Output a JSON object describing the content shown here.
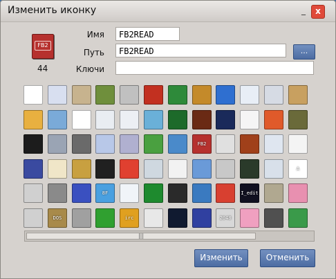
{
  "window": {
    "title": "Изменить иконку"
  },
  "titlebar": {
    "minimize_glyph": "_",
    "close_glyph": "x"
  },
  "icon_preview": {
    "label": "FB2",
    "index": "44"
  },
  "form": {
    "name_label": "Имя",
    "name_value": "FB2READ",
    "path_label": "Путь",
    "path_value": "FB2READ",
    "browse_label": "...",
    "keys_label": "Ключи",
    "keys_value": ""
  },
  "icon_grid": {
    "rows": [
      [
        {
          "name": "blank-window",
          "color": "#ffffff",
          "tag": ""
        },
        {
          "name": "checklist",
          "color": "#d8dff0",
          "tag": ""
        },
        {
          "name": "ubuntu-cd",
          "color": "#c7b38e",
          "tag": ""
        },
        {
          "name": "color-blocks",
          "color": "#6f8f3c",
          "tag": ""
        },
        {
          "name": "tic-tac-toe",
          "color": "#c0c0c0",
          "tag": ""
        },
        {
          "name": "mushroom",
          "color": "#c23020",
          "tag": ""
        },
        {
          "name": "chip-board",
          "color": "#2e8a3a",
          "tag": ""
        },
        {
          "name": "book-old",
          "color": "#c48a2a",
          "tag": ""
        },
        {
          "name": "xfce",
          "color": "#2f6fd0",
          "tag": ""
        },
        {
          "name": "mouse",
          "color": "#e8eef6",
          "tag": ""
        },
        {
          "name": "windows-stack",
          "color": "#d6dbe4",
          "tag": ""
        },
        {
          "name": "ship",
          "color": "#c8a060",
          "tag": ""
        }
      ],
      [
        {
          "name": "folder",
          "color": "#e8b040",
          "tag": ""
        },
        {
          "name": "monitor",
          "color": "#7aaad8",
          "tag": ""
        },
        {
          "name": "dots-molecule",
          "color": "#ffffff",
          "tag": ""
        },
        {
          "name": "text-window",
          "color": "#e9edf2",
          "tag": ""
        },
        {
          "name": "sudoku",
          "color": "#eceff4",
          "tag": ""
        },
        {
          "name": "map-window",
          "color": "#6ab0d8",
          "tag": ""
        },
        {
          "name": "cpu-chip",
          "color": "#1d6a2a",
          "tag": ""
        },
        {
          "name": "doom",
          "color": "#6a2a14",
          "tag": ""
        },
        {
          "name": "star-burst",
          "color": "#1a2a5a",
          "tag": ""
        },
        {
          "name": "document",
          "color": "#f5f5f5",
          "tag": ""
        },
        {
          "name": "window-colored",
          "color": "#e05a2a",
          "tag": ""
        },
        {
          "name": "tank",
          "color": "#6a6a3a",
          "tag": ""
        }
      ],
      [
        {
          "name": "terminal",
          "color": "#1c1c1c",
          "tag": ""
        },
        {
          "name": "cabinet",
          "color": "#9aa4b4",
          "tag": ""
        },
        {
          "name": "spike-ball",
          "color": "#6a6a6a",
          "tag": ""
        },
        {
          "name": "coins",
          "color": "#b8c8e8",
          "tag": ""
        },
        {
          "name": "p-tile",
          "color": "#b0b0d0",
          "tag": ""
        },
        {
          "name": "snake",
          "color": "#4aa040",
          "tag": ""
        },
        {
          "name": "circuit-board",
          "color": "#4a8aca",
          "tag": ""
        },
        {
          "name": "fb2-book",
          "color": "#b6312e",
          "tag": "FB2"
        },
        {
          "name": "disk-stack",
          "color": "#e0e0e0",
          "tag": ""
        },
        {
          "name": "q-logo",
          "color": "#a0401a",
          "tag": ""
        },
        {
          "name": "window-pair",
          "color": "#dfe6f0",
          "tag": ""
        },
        {
          "name": "cards",
          "color": "#f4f4f4",
          "tag": ""
        }
      ],
      [
        {
          "name": "floppy",
          "color": "#3a4aa0",
          "tag": ""
        },
        {
          "name": "notepad",
          "color": "#f0e6c8",
          "tag": ""
        },
        {
          "name": "tools-cross",
          "color": "#c8a040",
          "tag": ""
        },
        {
          "name": "black-window",
          "color": "#202020",
          "tag": ""
        },
        {
          "name": "rubik-cube",
          "color": "#e04030",
          "tag": ""
        },
        {
          "name": "network-window",
          "color": "#cfd8e0",
          "tag": ""
        },
        {
          "name": "bug",
          "color": "#f2f2f2",
          "tag": ""
        },
        {
          "name": "folder-blue",
          "color": "#6a9ad8",
          "tag": ""
        },
        {
          "name": "drive",
          "color": "#c8c8c8",
          "tag": ""
        },
        {
          "name": "monitor-graph",
          "color": "#2a3a2a",
          "tag": ""
        },
        {
          "name": "settings-window",
          "color": "#d8e0ea",
          "tag": ""
        },
        {
          "name": "font-a",
          "color": "#ffffff",
          "tag": "A"
        }
      ],
      [
        {
          "name": "calculator",
          "color": "#d0d0d0",
          "tag": ""
        },
        {
          "name": "umbrella",
          "color": "#8a8a8a",
          "tag": ""
        },
        {
          "name": "screen-blue",
          "color": "#3a50c0",
          "tag": ""
        },
        {
          "name": "8f-logo",
          "color": "#4aa0e0",
          "tag": "8F"
        },
        {
          "name": "spreadsheet",
          "color": "#f0f4f8",
          "tag": ""
        },
        {
          "name": "green-grid",
          "color": "#1e8a2e",
          "tag": ""
        },
        {
          "name": "play-button",
          "color": "#2a2a2a",
          "tag": ""
        },
        {
          "name": "ocean",
          "color": "#3a7ac0",
          "tag": ""
        },
        {
          "name": "calendar",
          "color": "#d84030",
          "tag": ""
        },
        {
          "name": "code-edit",
          "color": "#101020",
          "tag": "I_edit"
        },
        {
          "name": "speaker",
          "color": "#b0a890",
          "tag": ""
        },
        {
          "name": "flower-photo",
          "color": "#e890b0",
          "tag": ""
        }
      ],
      [
        {
          "name": "wrench-tools",
          "color": "#d0d0d0",
          "tag": ""
        },
        {
          "name": "dos-box",
          "color": "#a88a4a",
          "tag": "DOS"
        },
        {
          "name": "floppy-drive",
          "color": "#a0a0a0",
          "tag": ""
        },
        {
          "name": "mower",
          "color": "#30a030",
          "tag": ""
        },
        {
          "name": "irc",
          "color": "#e0a020",
          "tag": "irc"
        },
        {
          "name": "gamepad",
          "color": "#e8e8e8",
          "tag": ""
        },
        {
          "name": "equalizer",
          "color": "#101a30",
          "tag": ""
        },
        {
          "name": "tetris-blocks",
          "color": "#3040a0",
          "tag": ""
        },
        {
          "name": "number-puzzle",
          "color": "#d8d8d8",
          "tag": "2048"
        },
        {
          "name": "color-squares",
          "color": "#f0a0c0",
          "tag": ""
        },
        {
          "name": "speaker-box",
          "color": "#505050",
          "tag": ""
        },
        {
          "name": "ram-module",
          "color": "#3a9a4a",
          "tag": ""
        }
      ]
    ]
  },
  "scrollbar": {
    "grip": "|||"
  },
  "buttons": {
    "change": "Изменить",
    "cancel": "Отменить"
  }
}
